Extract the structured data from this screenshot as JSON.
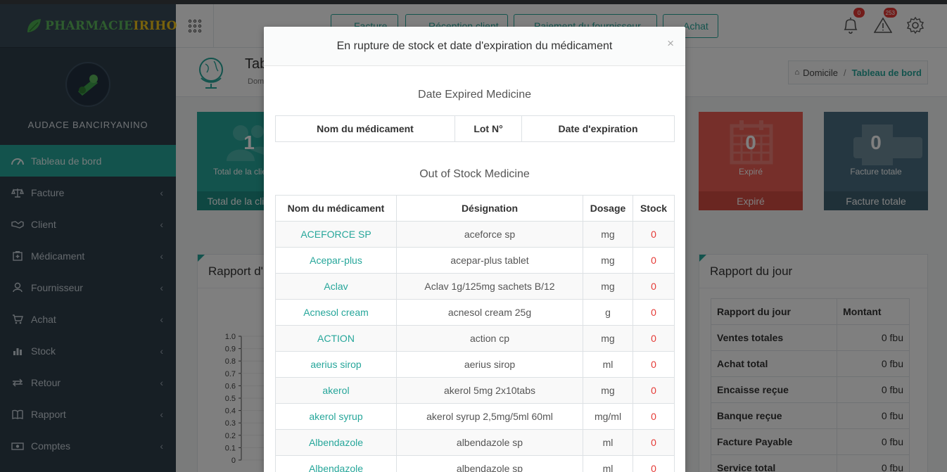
{
  "brand": {
    "logo_part1": "PHARMACIE",
    "logo_part2": "IRIHO"
  },
  "user": {
    "name": "AUDACE BANCIRYANINO"
  },
  "sidebar": {
    "items": [
      {
        "label": "Tableau de bord",
        "icon": "dashboard-icon",
        "active": true
      },
      {
        "label": "Facture",
        "icon": "balance-scale-icon"
      },
      {
        "label": "Client",
        "icon": "handshake-icon"
      },
      {
        "label": "Médicament",
        "icon": "medkit-icon"
      },
      {
        "label": "Fournisseur",
        "icon": "user-icon"
      },
      {
        "label": "Achat",
        "icon": "cart-icon"
      },
      {
        "label": "Stock",
        "icon": "bar-chart-icon"
      },
      {
        "label": "Retour",
        "icon": "exchange-icon"
      },
      {
        "label": "Rapport",
        "icon": "book-icon"
      },
      {
        "label": "Comptes",
        "icon": "money-icon"
      }
    ]
  },
  "header": {
    "buttons": [
      "Facture",
      "Réception client",
      "Paiement du fournisseur",
      "Achat"
    ],
    "notif_count": "0",
    "alert_count": "253"
  },
  "page": {
    "title": "Tableau de bord",
    "subtitle": "Domicile",
    "breadcrumb_home": "Domicile",
    "breadcrumb_current": "Tableau de bord"
  },
  "cards": [
    {
      "num": "1",
      "small": "Total de la clientèle",
      "foot": "Total de la clientèle"
    },
    {
      "num": "0",
      "small": "Expiré",
      "foot": "Expiré"
    },
    {
      "num": "0",
      "small": "Facture totale",
      "foot": "Facture totale"
    }
  ],
  "left_panel": {
    "title": "Rapport d'inventaire"
  },
  "chart_data": {
    "type": "line",
    "title": "",
    "xlabel": "",
    "ylabel": "",
    "ylim": [
      0,
      1.0
    ],
    "yticks": [
      "1.0",
      "0.9",
      "0.8",
      "0.7",
      "0.6",
      "0.5",
      "0.4",
      "0.3",
      "0.2",
      "0.1",
      "0"
    ],
    "series": []
  },
  "report": {
    "title": "Rapport du jour",
    "header": [
      "Rapport du jour",
      "Montant"
    ],
    "rows": [
      [
        "Ventes totales",
        "0 fbu"
      ],
      [
        "Achat total",
        "0 fbu"
      ],
      [
        "Encaisse reçue",
        "0 fbu"
      ],
      [
        "Banque reçue",
        "0 fbu"
      ],
      [
        "Facture Payable",
        "0 fbu"
      ],
      [
        "Service total",
        "0 fbu"
      ]
    ]
  },
  "modal": {
    "title": "En rupture de stock et date d'expiration du médicament",
    "close": "×",
    "expired_title": "Date Expired Medicine",
    "expired_headers": [
      "Nom du médicament",
      "Lot N°",
      "Date d'expiration"
    ],
    "oos_title": "Out of Stock Medicine",
    "oos_headers": [
      "Nom du médicament",
      "Désignation",
      "Dosage",
      "Stock"
    ],
    "oos_rows": [
      [
        "ACEFORCE SP",
        "aceforce sp",
        "mg",
        "0"
      ],
      [
        "Acepar-plus",
        "acepar-plus tablet",
        "mg",
        "0"
      ],
      [
        "Aclav",
        "Aclav 1g/125mg sachets B/12",
        "mg",
        "0"
      ],
      [
        "Acnesol cream",
        "acnesol cream 25g",
        "g",
        "0"
      ],
      [
        "ACTION",
        "action cp",
        "mg",
        "0"
      ],
      [
        "aerius sirop",
        "aerius sirop",
        "ml",
        "0"
      ],
      [
        "akerol",
        "akerol 5mg 2x10tabs",
        "mg",
        "0"
      ],
      [
        "akerol syrup",
        "akerol syrup 2,5mg/5ml 60ml",
        "mg/ml",
        "0"
      ],
      [
        "Albendazole",
        "albendazole sp",
        "ml",
        "0"
      ],
      [
        "Albendazole",
        "albendazole sp",
        "ml",
        "0"
      ]
    ]
  },
  "colors": {
    "accent": "#26a69a",
    "sidebar": "#2f3e4b",
    "danger": "#e53935"
  }
}
